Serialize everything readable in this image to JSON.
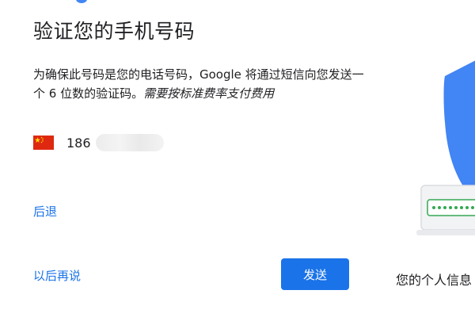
{
  "header": {
    "title": "验证您的手机号码"
  },
  "description": {
    "main_text": "为确保此号码是您的电话号码，Google 将通过短信向您发送一个 6 位数的验证码。",
    "note_text": "需要按标准费率支付费用"
  },
  "phone": {
    "country_flag_icon": "china-flag-icon",
    "prefix": "186",
    "rest_obscured": true
  },
  "actions": {
    "back_label": "后退",
    "later_label": "以后再说",
    "send_label": "发送"
  },
  "illustration": {
    "icon": "security-shield-illustration",
    "caption": "您的个人信息"
  },
  "colors": {
    "link": "#1a73e8",
    "button": "#1a73e8",
    "shield": "#4285f4",
    "flag_red": "#de2910",
    "flag_star": "#ffde00",
    "password_green": "#34a853"
  }
}
